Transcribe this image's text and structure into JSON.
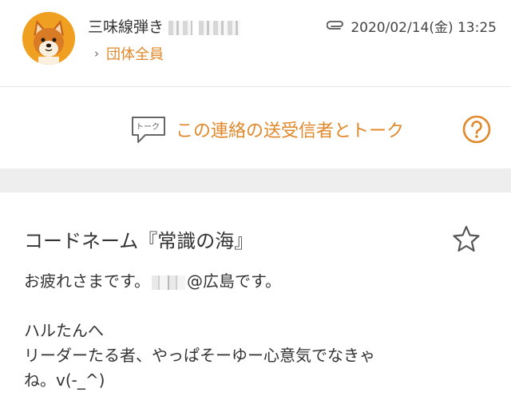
{
  "header": {
    "sender_name": "三味線弾き",
    "timestamp": "2020/02/14(金) 13:25",
    "attachment_icon": "paperclip-icon",
    "recipient": "団体全員"
  },
  "talk": {
    "icon_label": "トーク",
    "link": "この連絡の送受信者とトーク",
    "help_icon": "question-circle-icon"
  },
  "message": {
    "subject": "コードネーム『常識の海』",
    "star_icon": "star-outline-icon",
    "greeting_before": "お疲れさまです。",
    "greeting_after": "@広島です。",
    "line1": "ハルたんへ",
    "line2": "リーダーたる者、やっぱそーゆー心意気でなきゃ",
    "line3": "ね。v(-_^)"
  },
  "colors": {
    "accent": "#e0882a",
    "text": "#333333",
    "band": "#eeeeee",
    "avatar_bg": "#f0a020"
  }
}
